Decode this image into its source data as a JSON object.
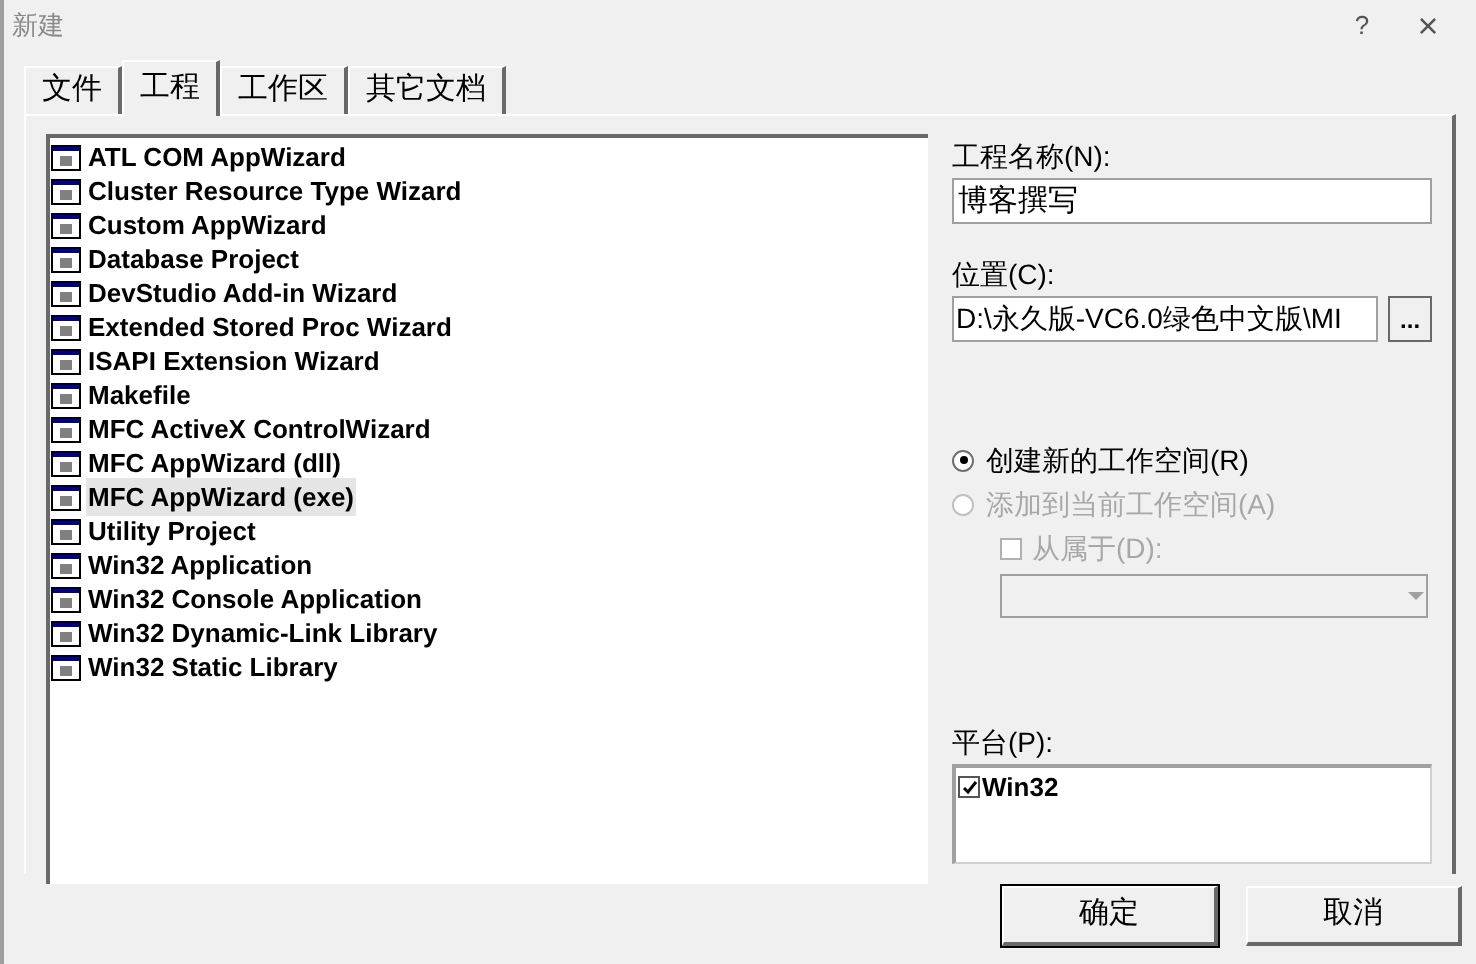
{
  "window": {
    "title": "新建",
    "help": "?",
    "close": "×"
  },
  "tabs": [
    {
      "label": "文件",
      "selected": false
    },
    {
      "label": "工程",
      "selected": true
    },
    {
      "label": "工作区",
      "selected": false
    },
    {
      "label": "其它文档",
      "selected": false
    }
  ],
  "project_types": [
    {
      "label": "ATL COM AppWizard",
      "selected": false
    },
    {
      "label": "Cluster Resource Type Wizard",
      "selected": false
    },
    {
      "label": "Custom AppWizard",
      "selected": false
    },
    {
      "label": "Database Project",
      "selected": false
    },
    {
      "label": "DevStudio Add-in Wizard",
      "selected": false
    },
    {
      "label": "Extended Stored Proc Wizard",
      "selected": false
    },
    {
      "label": "ISAPI Extension Wizard",
      "selected": false
    },
    {
      "label": "Makefile",
      "selected": false
    },
    {
      "label": "MFC ActiveX ControlWizard",
      "selected": false
    },
    {
      "label": "MFC AppWizard (dll)",
      "selected": false
    },
    {
      "label": "MFC AppWizard (exe)",
      "selected": true
    },
    {
      "label": "Utility Project",
      "selected": false
    },
    {
      "label": "Win32 Application",
      "selected": false
    },
    {
      "label": "Win32 Console Application",
      "selected": false
    },
    {
      "label": "Win32 Dynamic-Link Library",
      "selected": false
    },
    {
      "label": "Win32 Static Library",
      "selected": false
    }
  ],
  "project_name": {
    "label": "工程名称(N):",
    "value": "博客撰写"
  },
  "location": {
    "label": "位置(C):",
    "value": "D:\\永久版-VC6.0绿色中文版\\MI",
    "browse": "..."
  },
  "workspace_options": [
    {
      "label": "创建新的工作空间(R)",
      "selected": true,
      "disabled": false
    },
    {
      "label": "添加到当前工作空间(A)",
      "selected": false,
      "disabled": true
    }
  ],
  "dependency": {
    "label": "从属于(D):",
    "checked": false,
    "disabled": true
  },
  "platforms": {
    "label": "平台(P):",
    "items": [
      {
        "label": "Win32",
        "checked": true
      }
    ]
  },
  "buttons": [
    {
      "label": "确定"
    },
    {
      "label": "取消"
    }
  ]
}
